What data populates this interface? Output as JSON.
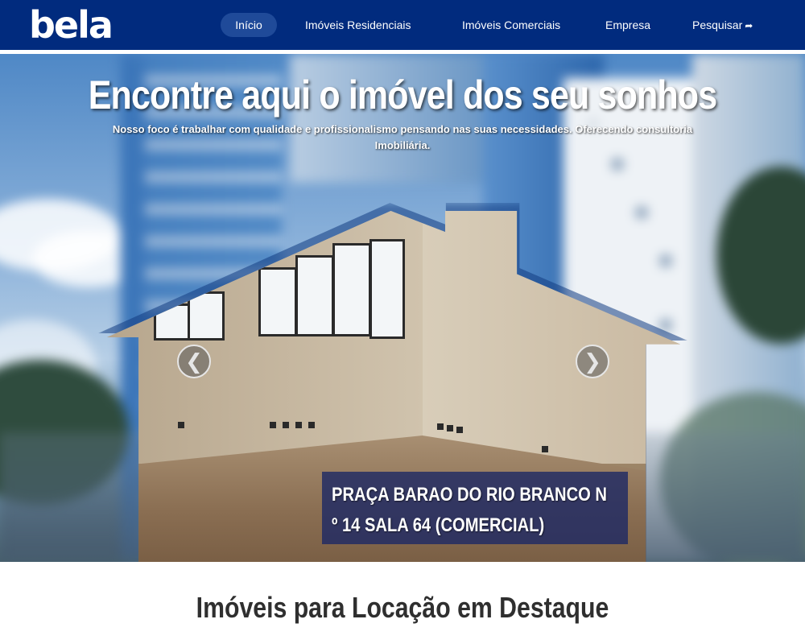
{
  "brand": {
    "logo": "bela"
  },
  "nav": {
    "items": [
      {
        "label": "Início",
        "active": true
      },
      {
        "label": "Imóveis Residenciais"
      },
      {
        "label": "Imóveis Comerciais"
      },
      {
        "label": "Empresa"
      },
      {
        "label": "Pesquisar"
      }
    ],
    "search_icon": "share-arrow-icon"
  },
  "hero": {
    "title": "Encontre aqui o imóvel dos seu sonhos",
    "subtitle_line1": "Nosso foco é trabalhar com qualidade e profissionalismo pensando nas suas necessidades. Oferecendo consultoria",
    "subtitle_line2": "Imobiliária.",
    "slide": {
      "caption_line1": "PRAÇA BARAO DO RIO BRANCO N",
      "caption_line2": "º 14 SALA 64 (COMERCIAL)"
    },
    "prev_icon": "chevron-left-icon",
    "next_icon": "chevron-right-icon",
    "prev_glyph": "❮",
    "next_glyph": "❯"
  },
  "featured": {
    "title": "Imóveis para Locação em Destaque"
  },
  "colors": {
    "navbar": "#012b7e",
    "active_pill": "#1f4a99",
    "caption_bg": "#1e2a64"
  }
}
